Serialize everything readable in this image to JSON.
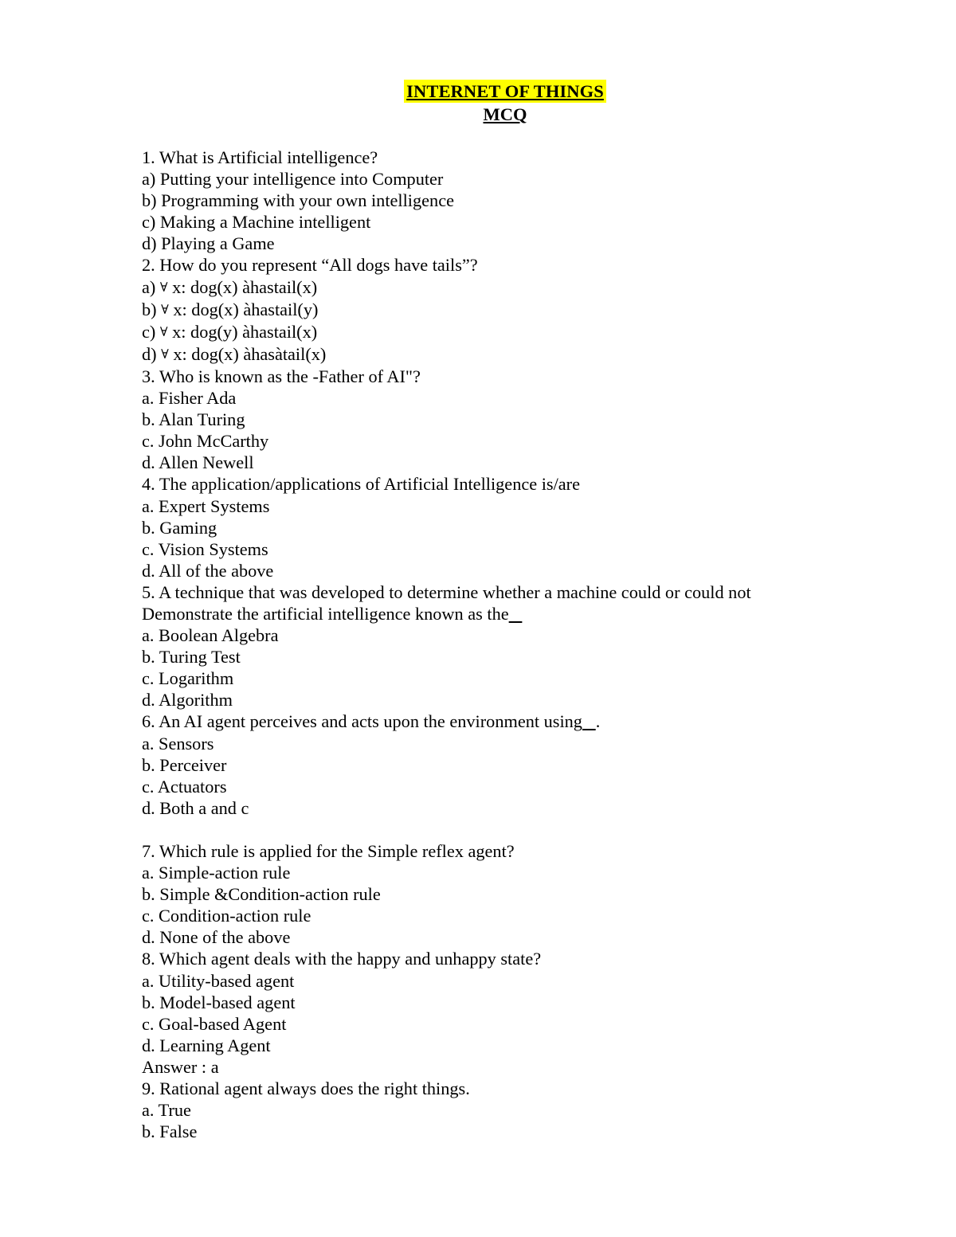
{
  "document": {
    "title": "INTERNET OF THINGS",
    "subtitle": "MCQ",
    "highlight_color": "#FFFF00",
    "lines": [
      {
        "id": "q1",
        "text": "1. What is Artificial intelligence?"
      },
      {
        "id": "q1a",
        "text": "a) Putting your intelligence into Computer"
      },
      {
        "id": "q1b",
        "text": "b) Programming with your own intelligence"
      },
      {
        "id": "q1c",
        "text": "c) Making a Machine intelligent"
      },
      {
        "id": "q1d",
        "text": "d) Playing a Game"
      },
      {
        "id": "q2",
        "text": "2. How do you represent “All dogs have tails”?"
      },
      {
        "id": "q2a",
        "text": "a) ∀ x: dog(x) àhastail(x)"
      },
      {
        "id": "q2b",
        "text": "b) ∀ x: dog(x) àhastail(y)"
      },
      {
        "id": "q2c",
        "text": "c) ∀ x: dog(y) àhastail(x)"
      },
      {
        "id": "q2d",
        "text": "d) ∀ x: dog(x) àhasàtail(x)"
      },
      {
        "id": "q3",
        "text": "3. Who is known as the -Father of AI\"?"
      },
      {
        "id": "q3a",
        "text": "a. Fisher Ada"
      },
      {
        "id": "q3b",
        "text": "b. Alan Turing"
      },
      {
        "id": "q3c",
        "text": "c. John McCarthy"
      },
      {
        "id": "q3d",
        "text": "d. Allen Newell"
      },
      {
        "id": "q4",
        "text": "4. The application/applications of Artificial Intelligence is/are"
      },
      {
        "id": "q4a",
        "text": "a. Expert Systems"
      },
      {
        "id": "q4b",
        "text": "b. Gaming"
      },
      {
        "id": "q4c",
        "text": "c. Vision Systems"
      },
      {
        "id": "q4d",
        "text": "d. All of the above"
      },
      {
        "id": "q5",
        "text": "5. A technique that was developed to determine whether a machine could or could not"
      },
      {
        "id": "q5cont",
        "text": "Demonstrate the artificial intelligence known as the___"
      },
      {
        "id": "q5a",
        "text": "a. Boolean Algebra"
      },
      {
        "id": "q5b",
        "text": "b. Turing Test"
      },
      {
        "id": "q5c",
        "text": "c. Logarithm"
      },
      {
        "id": "q5d",
        "text": "d. Algorithm"
      },
      {
        "id": "q6",
        "text": "6. An AI agent perceives and acts upon the environment using___."
      },
      {
        "id": "q6a",
        "text": "a. Sensors"
      },
      {
        "id": "q6b",
        "text": "b. Perceiver"
      },
      {
        "id": "q6c",
        "text": "c. Actuators"
      },
      {
        "id": "q6d",
        "text": "d. Both a and c"
      },
      {
        "id": "gap1",
        "text": ""
      },
      {
        "id": "q7",
        "text": "7. Which rule is applied for the Simple reflex agent?"
      },
      {
        "id": "q7a",
        "text": "a. Simple-action rule"
      },
      {
        "id": "q7b",
        "text": "b. Simple &Condition-action rule"
      },
      {
        "id": "q7c",
        "text": "c. Condition-action rule"
      },
      {
        "id": "q7d",
        "text": "d. None of the above"
      },
      {
        "id": "q8",
        "text": "8. Which agent deals with the happy and unhappy state?"
      },
      {
        "id": "q8a",
        "text": "a. Utility-based agent"
      },
      {
        "id": "q8b",
        "text": "b. Model-based agent"
      },
      {
        "id": "q8c",
        "text": "c. Goal-based Agent"
      },
      {
        "id": "q8d",
        "text": "d. Learning Agent"
      },
      {
        "id": "q8ans",
        "text": "Answer : a"
      },
      {
        "id": "q9",
        "text": "9. Rational agent always does the right things."
      },
      {
        "id": "q9a",
        "text": "a. True"
      },
      {
        "id": "q9b",
        "text": "b. False"
      }
    ]
  }
}
